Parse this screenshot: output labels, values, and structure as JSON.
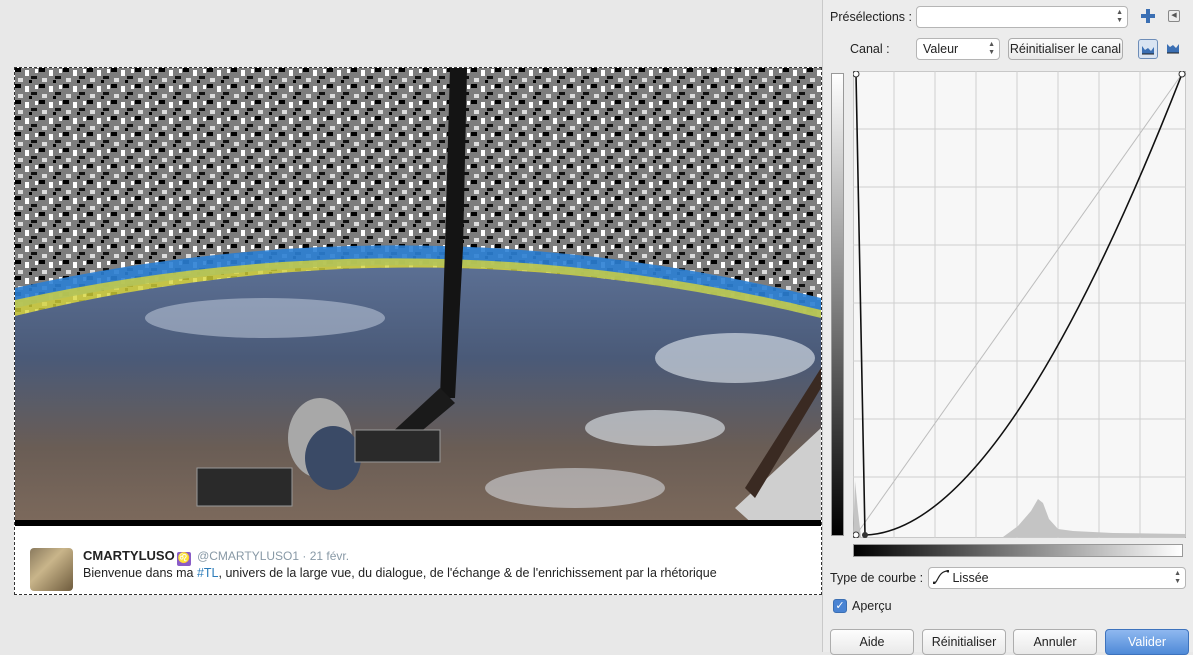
{
  "tweet": {
    "name": "CMARTYLUSO",
    "badge": "♌",
    "handle": "@CMARTYLUSO1",
    "separator": "·",
    "date": "21 févr.",
    "text_before": "Bienvenue dans ma ",
    "hashtag": "#TL",
    "text_after": ", univers de la large vue, du dialogue, de l'échange & de l'enrichissement par la rhétorique"
  },
  "dialog": {
    "presets_label": "Présélections :",
    "presets_value": "",
    "add_preset_icon": "plus-icon",
    "preset_menu_icon": "menu-arrow-icon",
    "channel_label": "Canal :",
    "channel_value": "Valeur",
    "reset_channel_label": "Réinitialiser le canal",
    "linear_histogram_icon": "linear-histogram-icon",
    "log_histogram_icon": "log-histogram-icon",
    "curve_type_label": "Type de courbe :",
    "curve_type_value": "Lissée",
    "curve_type_icon": "smooth-curve-icon",
    "preview_label": "Aperçu",
    "preview_checked": true,
    "buttons": {
      "help": "Aide",
      "reset": "Réinitialiser",
      "cancel": "Annuler",
      "ok": "Valider"
    }
  },
  "colors": {
    "accent": "#4f8ad8",
    "hashtag": "#2b7bb9",
    "badge": "#8a5cc6",
    "dialog_bg": "#ececec"
  }
}
